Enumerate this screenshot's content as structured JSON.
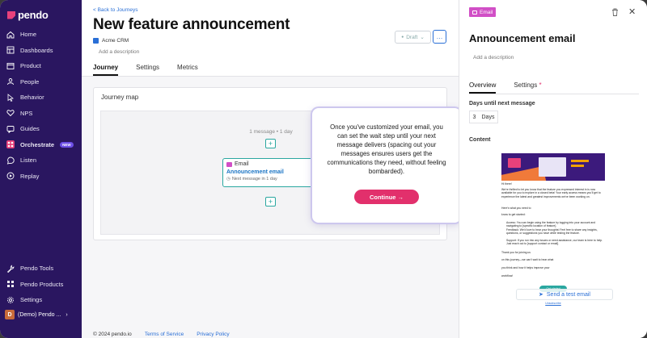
{
  "brand": {
    "name": "pendo",
    "accent": "#e8417b",
    "sidebar_bg": "#2a1660"
  },
  "sidebar": {
    "items": [
      {
        "label": "Home",
        "icon": "home-icon"
      },
      {
        "label": "Dashboards",
        "icon": "dashboard-icon"
      },
      {
        "label": "Product",
        "icon": "product-icon"
      },
      {
        "label": "People",
        "icon": "people-icon"
      },
      {
        "label": "Behavior",
        "icon": "behavior-icon"
      },
      {
        "label": "NPS",
        "icon": "heart-icon"
      },
      {
        "label": "Guides",
        "icon": "guides-icon"
      },
      {
        "label": "Orchestrate",
        "icon": "orchestrate-icon",
        "badge": "NEW",
        "active": true
      },
      {
        "label": "Listen",
        "icon": "listen-icon"
      },
      {
        "label": "Replay",
        "icon": "replay-icon"
      }
    ],
    "bottom_items": [
      {
        "label": "Pendo Tools",
        "icon": "tools-icon"
      },
      {
        "label": "Pendo Products",
        "icon": "grid-icon"
      },
      {
        "label": "Settings",
        "icon": "gear-icon"
      }
    ],
    "org": {
      "initial": "D",
      "label": "(Demo) Pendo ..."
    }
  },
  "main": {
    "back_link": "< Back to Journeys",
    "title": "New feature announcement",
    "app_name": "Acme CRM",
    "description_placeholder": "Add a description",
    "status": "Draft",
    "more": "…",
    "tabs": [
      "Journey",
      "Settings",
      "Metrics"
    ],
    "active_tab": "Journey",
    "map": {
      "title": "Journey map",
      "wait_label": "1 message • 1 day",
      "node": {
        "type": "Email",
        "title": "Announcement email",
        "subtitle": "Next message in 1 day"
      }
    },
    "footer": {
      "copyright": "© 2024 pendo.io",
      "terms": "Terms of Service",
      "privacy": "Privacy Policy"
    }
  },
  "popover": {
    "text": "Once you've customized your email, you can set the wait step until your next message delivers (spacing out your messages ensures users get the communications they need, without feeling bombarded).",
    "button": "Continue →"
  },
  "panel": {
    "chip": "Email",
    "title": "Announcement email",
    "description_placeholder": "Add a description",
    "tabs": [
      {
        "label": "Overview"
      },
      {
        "label": "Settings",
        "required": "*"
      }
    ],
    "days_label": "Days until next message",
    "days_value": "3",
    "days_unit": "Days",
    "content_label": "Content",
    "preview": {
      "greeting": "Hi there!",
      "p1": "We're thrilled to let you know that the feature you expressed interest in is now available for you to explore in a closed beta! Your early access means you'll get to experience the latest and greatest improvements we've been working on.",
      "p2": "Here's what you need to",
      "p3": "know to get started:",
      "b1": "Access: You can begin using the feature by logging into your account and navigating to [specific location of feature].",
      "b2": "Feedback: We'd love to hear your thoughts! Feel free to share any insights, questions, or suggestions you have while testing the feature.",
      "b3": "Support: If you run into any issues or need assistance, our team is here to help. Just reach out to [support contact or email].",
      "p4": "Thank you for joining us",
      "p5": "on this journey—we can't wait to hear what",
      "p6": "you think and how it helps improve your",
      "p7": "workflow!",
      "cta": "Get started",
      "unsubscribe": "Unsubscribe"
    },
    "send_test": "Send a test email"
  }
}
